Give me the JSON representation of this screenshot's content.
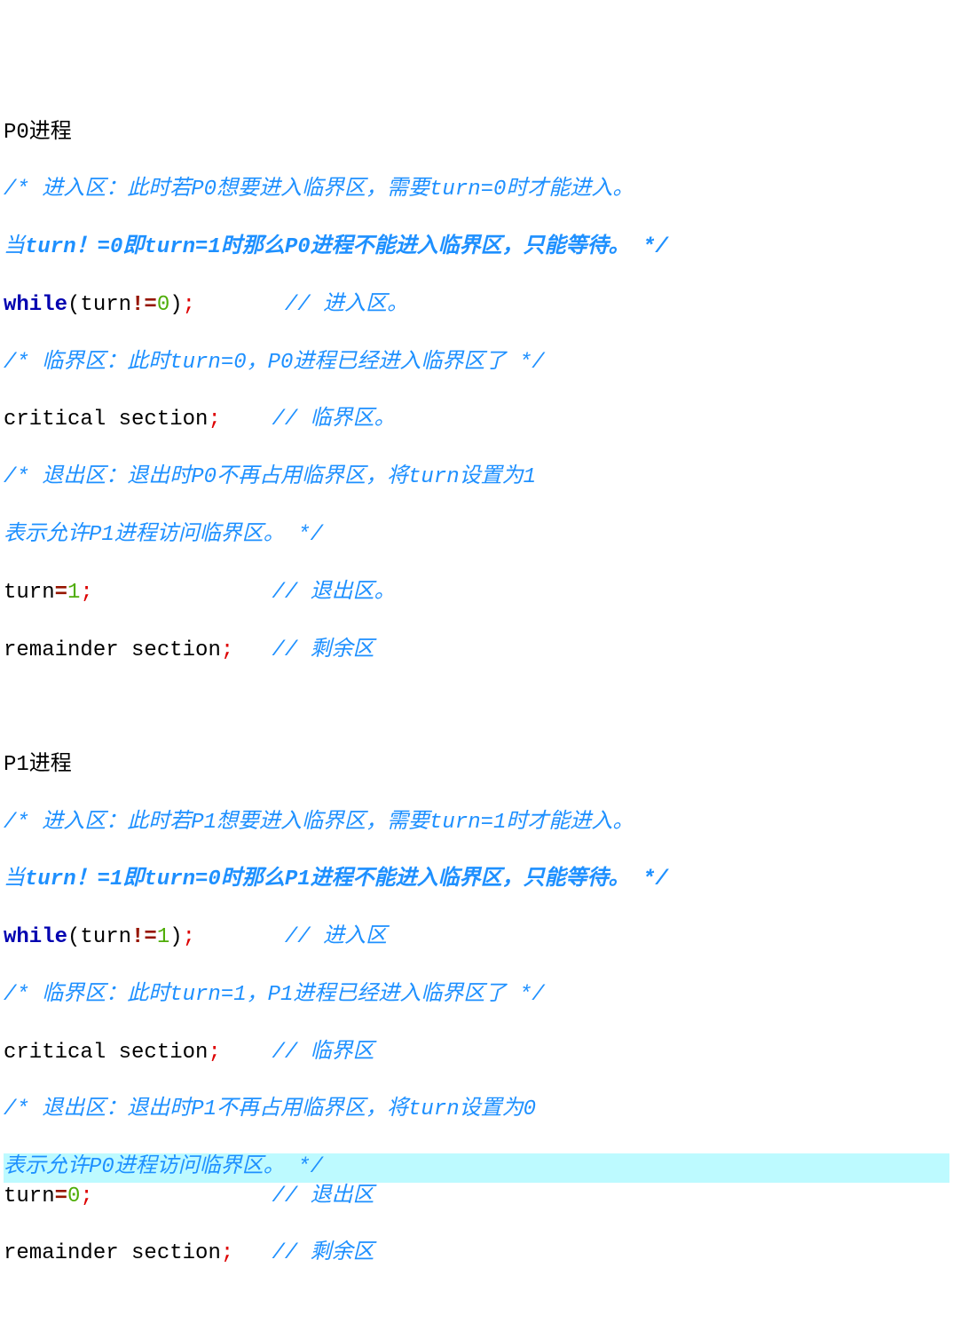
{
  "p0": {
    "title": "P0进程",
    "entry_comment1": "/* 进入区：此时若P0想要进入临界区，需要turn=0时才能进入。",
    "entry_comment2a": "当",
    "entry_comment2b": "turn！=0即turn=1时那么P0进程不能进入临界区，只能等待。 */",
    "while_kw": "while",
    "while_open": "(turn",
    "while_op": "!=",
    "while_num": "0",
    "while_close": ")",
    "semi": ";",
    "entry_line_comment": "// 进入区。",
    "crit_comment": "/* 临界区：此时turn=0，P0进程已经进入临界区了 */",
    "crit_code": "critical section",
    "crit_line_comment": "// 临界区。",
    "exit_comment1": "/* 退出区：退出时P0不再占用临界区，将turn设置为1",
    "exit_comment2": "表示允许P1进程访问临界区。 */",
    "turn_assign": "turn",
    "eq": "=",
    "turn_val": "1",
    "exit_line_comment": "// 退出区。",
    "rem_code": "remainder section",
    "rem_line_comment": "// 剩余区"
  },
  "p1": {
    "title": "P1进程",
    "entry_comment1": "/* 进入区：此时若P1想要进入临界区，需要turn=1时才能进入。",
    "entry_comment2a": "当",
    "entry_comment2b": "turn！=1即turn=0时那么P1进程不能进入临界区，只能等待。 */",
    "while_kw": "while",
    "while_open": "(turn",
    "while_op": "!=",
    "while_num": "1",
    "while_close": ")",
    "semi": ";",
    "entry_line_comment": "// 进入区",
    "crit_comment": "/* 临界区：此时turn=1，P1进程已经进入临界区了 */",
    "crit_code": "critical section",
    "crit_line_comment": "// 临界区",
    "exit_comment1": "/* 退出区：退出时P1不再占用临界区，将turn设置为0",
    "exit_comment2": "表示允许P0进程访问临界区。 */",
    "turn_assign": "turn",
    "eq": "=",
    "turn_val": "0",
    "exit_line_comment": "// 退出区",
    "rem_code": "remainder section",
    "rem_line_comment": "// 剩余区"
  }
}
